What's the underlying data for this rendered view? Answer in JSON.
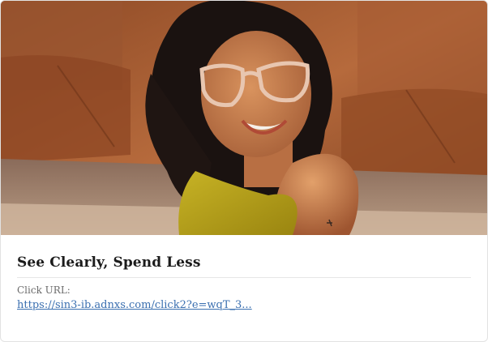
{
  "ad": {
    "image_alt": "Woman with curly hair wearing light pink cat-eye glasses, smiling, sitting in front of a brown leather sofa",
    "title": "See Clearly, Spend Less",
    "click_url_label": "Click URL:",
    "click_url": "https://sin3-ib.adnxs.com/click2?e=wqT_3..."
  },
  "colors": {
    "link": "#3a6fb0",
    "title": "#1b1b1b",
    "leather": "#a4582f",
    "dress": "#b7a21a"
  }
}
